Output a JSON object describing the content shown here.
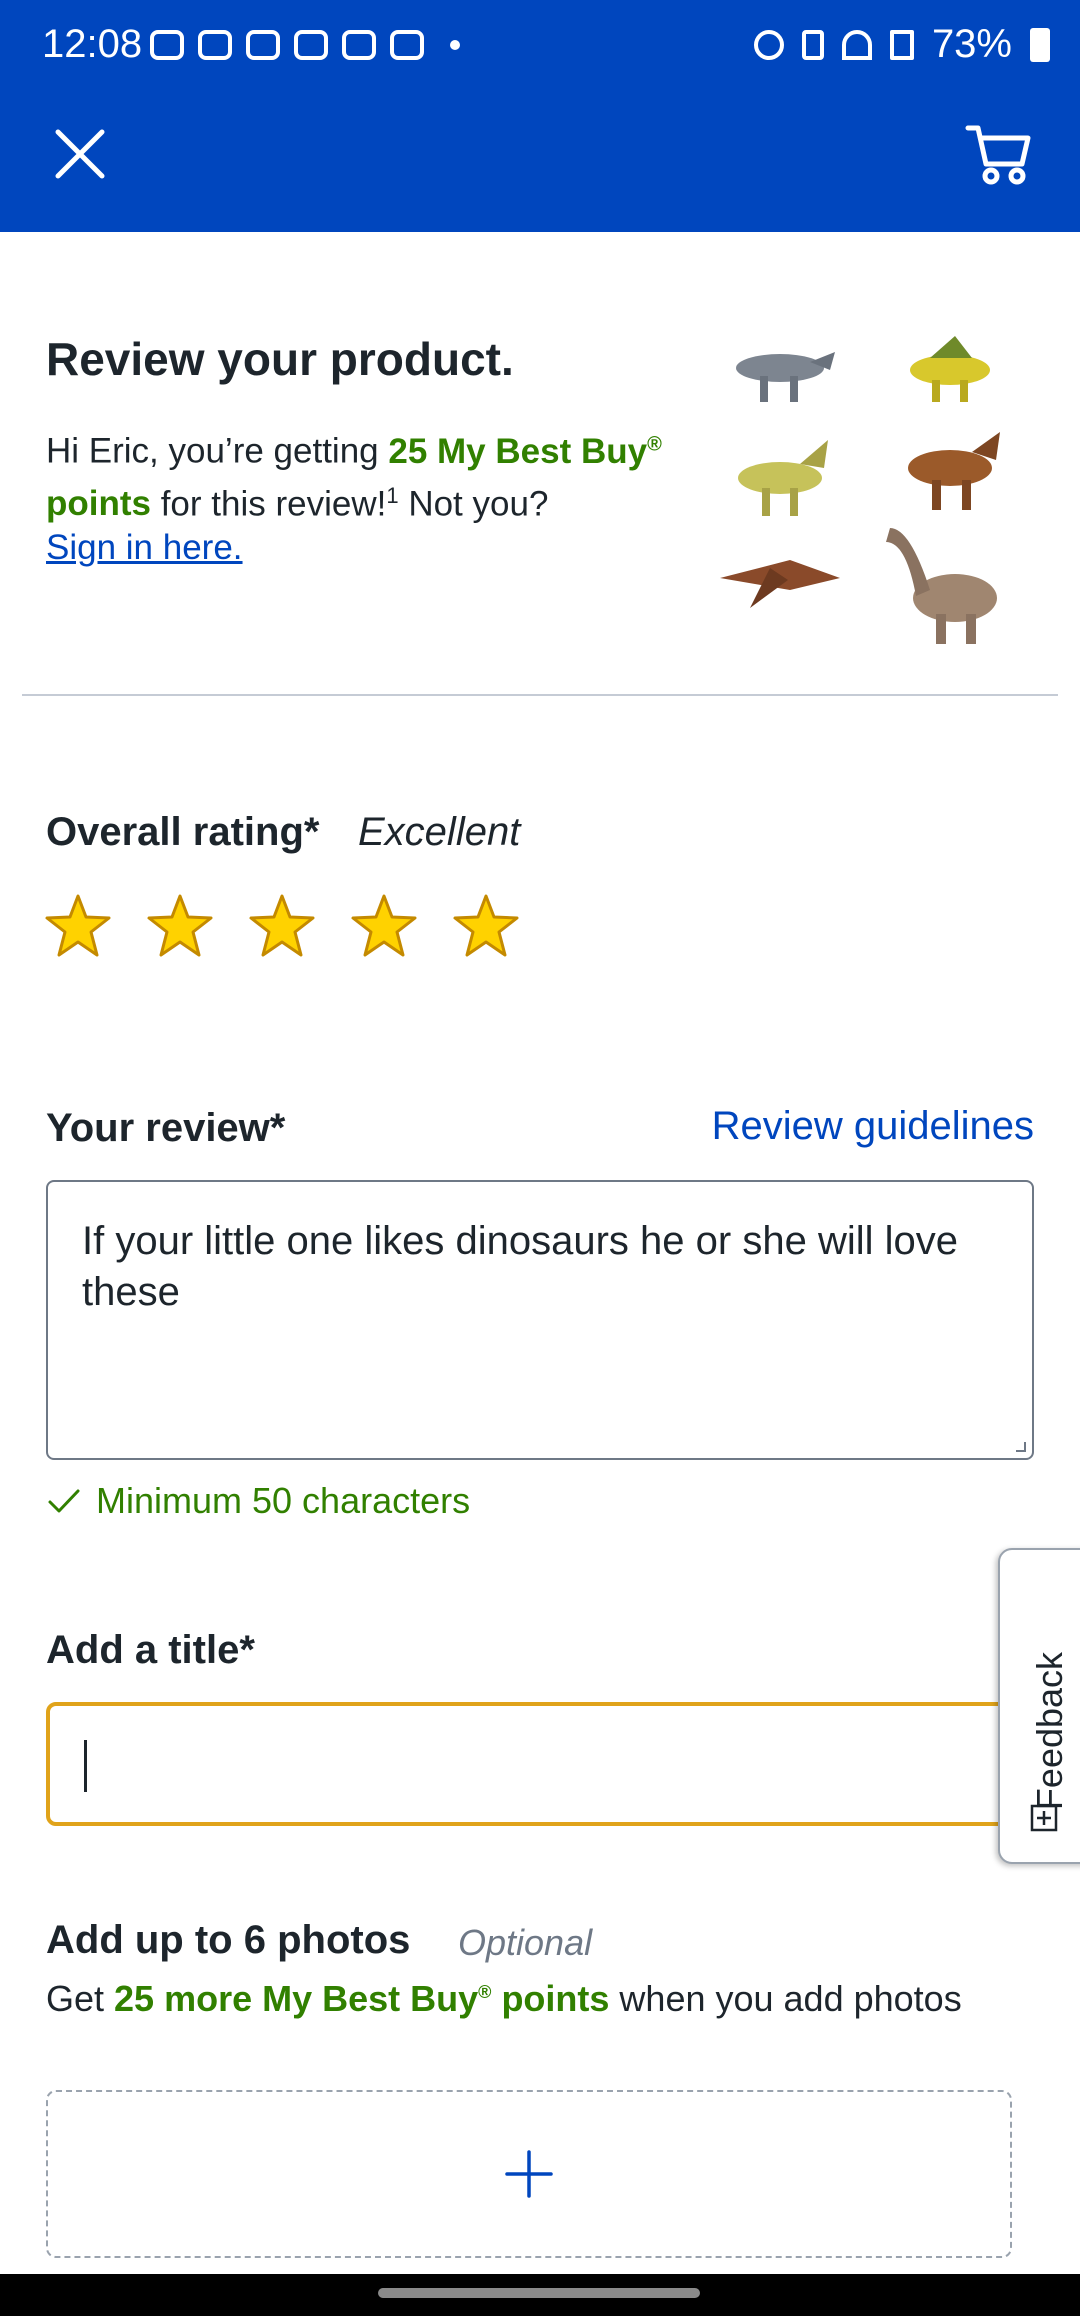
{
  "status_bar": {
    "time": "12:08",
    "battery": "73%"
  },
  "app_bar": {
    "close_icon": "close-icon",
    "cart_icon": "cart-icon"
  },
  "header": {
    "title": "Review your product.",
    "greeting_pre": "Hi Eric, you’re getting ",
    "points": "25 My Best Buy",
    "points_reg": "®",
    "points_suffix": " points",
    "greeting_post": " for this review!",
    "footnote": "1",
    "not_you": " Not you? ",
    "sign_in": "Sign in here."
  },
  "rating": {
    "label": "Overall rating*",
    "value": "Excellent",
    "stars": 5,
    "star_color": "#ffd200"
  },
  "review": {
    "label": "Your review*",
    "guidelines": "Review guidelines",
    "text": "If your little one likes dinosaurs he or she will love these",
    "min_chars": "Minimum 50 characters"
  },
  "title_field": {
    "label": "Add a title*",
    "value": ""
  },
  "feedback": {
    "label": "Feedback"
  },
  "photos": {
    "label": "Add up to 6 photos",
    "optional": "Optional",
    "sub_pre": "Get ",
    "sub_points": "25 more My Best Buy",
    "sub_reg": "®",
    "sub_points_suffix": " points",
    "sub_post": " when you add photos"
  },
  "colors": {
    "brand_blue": "#0046be",
    "points_green": "#318000",
    "focus_yellow": "#e0a31a"
  }
}
